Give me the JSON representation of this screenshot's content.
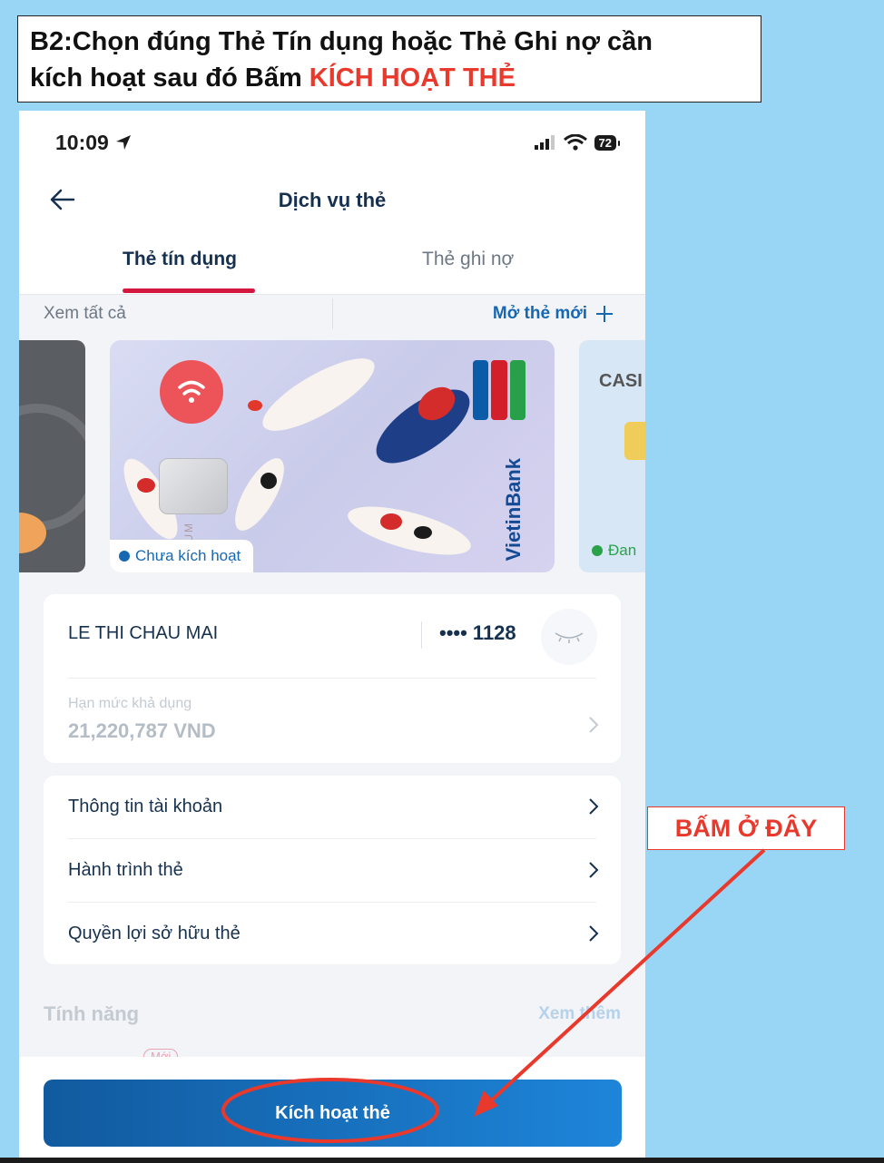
{
  "instruction": {
    "line1": "B2:Chọn đúng  Thẻ Tín dụng hoặc Thẻ Ghi nợ cần",
    "line2_prefix": "kích hoạt sau đó Bấm ",
    "line2_highlight": "KÍCH HOẠT THẺ"
  },
  "status_bar": {
    "time": "10:09",
    "battery": "72"
  },
  "header": {
    "title": "Dịch vụ thẻ"
  },
  "tabs": [
    {
      "label": "Thẻ tín dụng",
      "active": true
    },
    {
      "label": "Thẻ ghi nợ",
      "active": false
    }
  ],
  "cards_section": {
    "see_all": "Xem tất cả",
    "open_new": "Mở thẻ mới",
    "selected_card_status": "Chưa kích hoạt",
    "next_card_brand": "CASI",
    "next_card_status": "Đan",
    "selected_card_texts": {
      "bank": "VietinBank",
      "tier": "PLATINUM"
    }
  },
  "card_info": {
    "holder_name": "LE THI CHAU MAI",
    "card_number_masked": "•••• 1128",
    "limit_label": "Hạn mức khả dụng",
    "limit_value": "21,220,787 VND"
  },
  "menu": [
    {
      "label": "Thông tin tài khoản"
    },
    {
      "label": "Hành trình thẻ"
    },
    {
      "label": "Quyền lợi sở hữu thẻ"
    }
  ],
  "features": {
    "title": "Tính năng",
    "see_more": "Xem thêm",
    "new_badge": "Mới"
  },
  "action_button": {
    "label": "Kích hoạt thẻ"
  },
  "callout": {
    "label": "BẤM Ở ĐÂY"
  },
  "colors": {
    "accent_red": "#e8392c",
    "brand_blue": "#1768b3",
    "tab_underline": "#d4173f",
    "background": "#99d6f6"
  }
}
